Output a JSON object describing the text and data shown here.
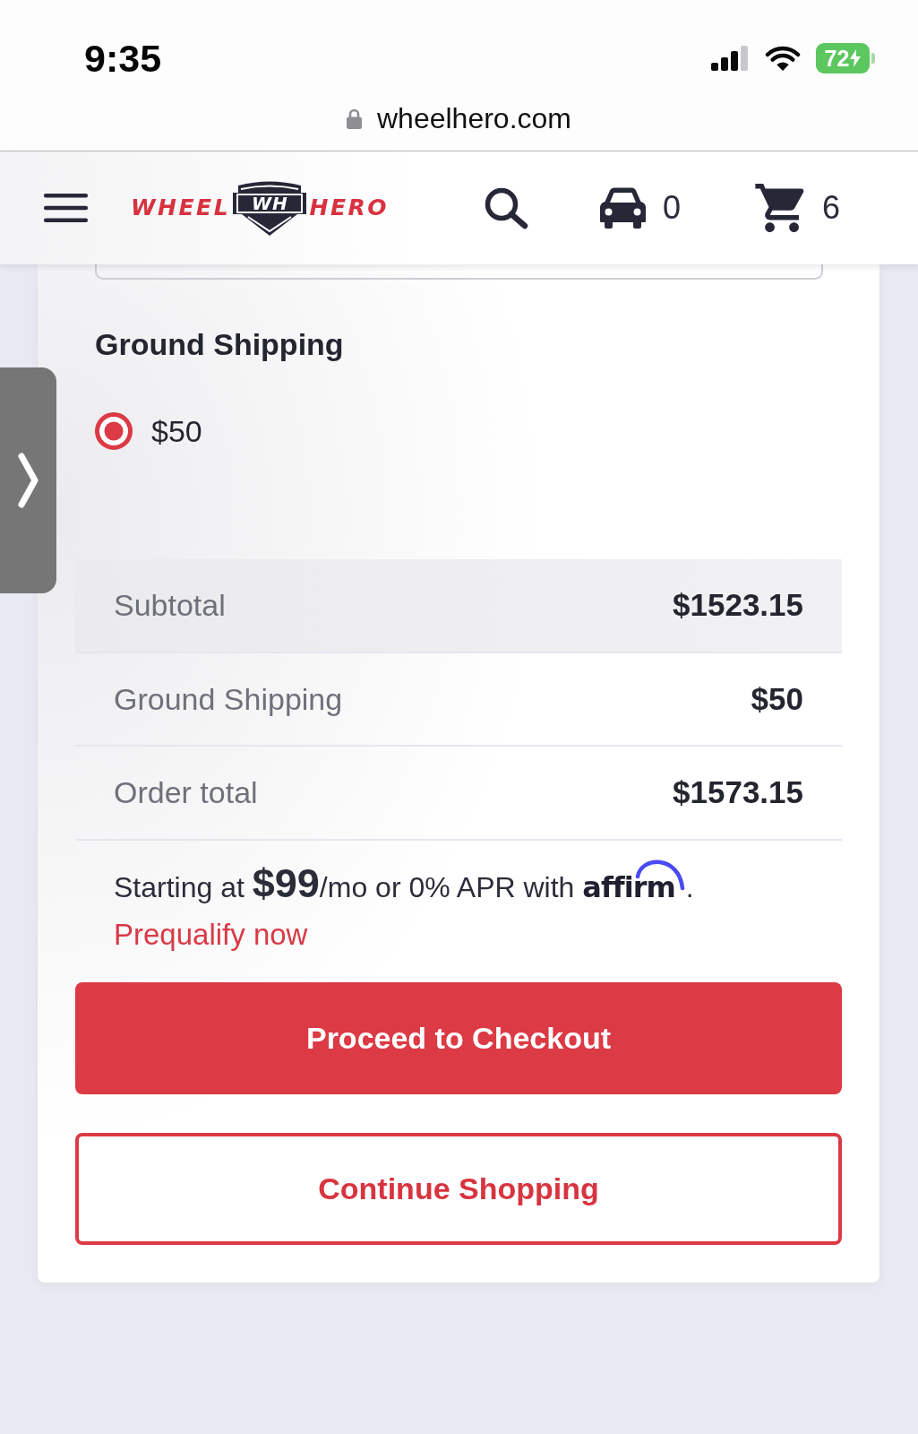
{
  "status_bar": {
    "time": "9:35",
    "battery": "72"
  },
  "address_bar": {
    "url": "wheelhero.com"
  },
  "header": {
    "logo": {
      "left": "WHEEL",
      "emblem": "WH",
      "right": "HERO"
    },
    "garage_count": "0",
    "cart_count": "6"
  },
  "shipping": {
    "title": "Ground Shipping",
    "options": [
      {
        "label": "$50",
        "selected": true
      }
    ]
  },
  "summary": {
    "rows": [
      {
        "label": "Subtotal",
        "value": "$1523.15",
        "highlighted": true
      },
      {
        "label": "Ground Shipping",
        "value": "$50",
        "highlighted": false
      },
      {
        "label": "Order total",
        "value": "$1573.15",
        "highlighted": false
      }
    ]
  },
  "financing": {
    "text": "Starting at **$99**/mo or 0% APR with",
    "brand": "affirm",
    "end": ".",
    "link": "Prequalify now"
  },
  "buttons": [
    {
      "label": "Proceed to Checkout",
      "kind": "primary"
    },
    {
      "label": "Continue Shopping",
      "kind": "secondary"
    }
  ]
}
